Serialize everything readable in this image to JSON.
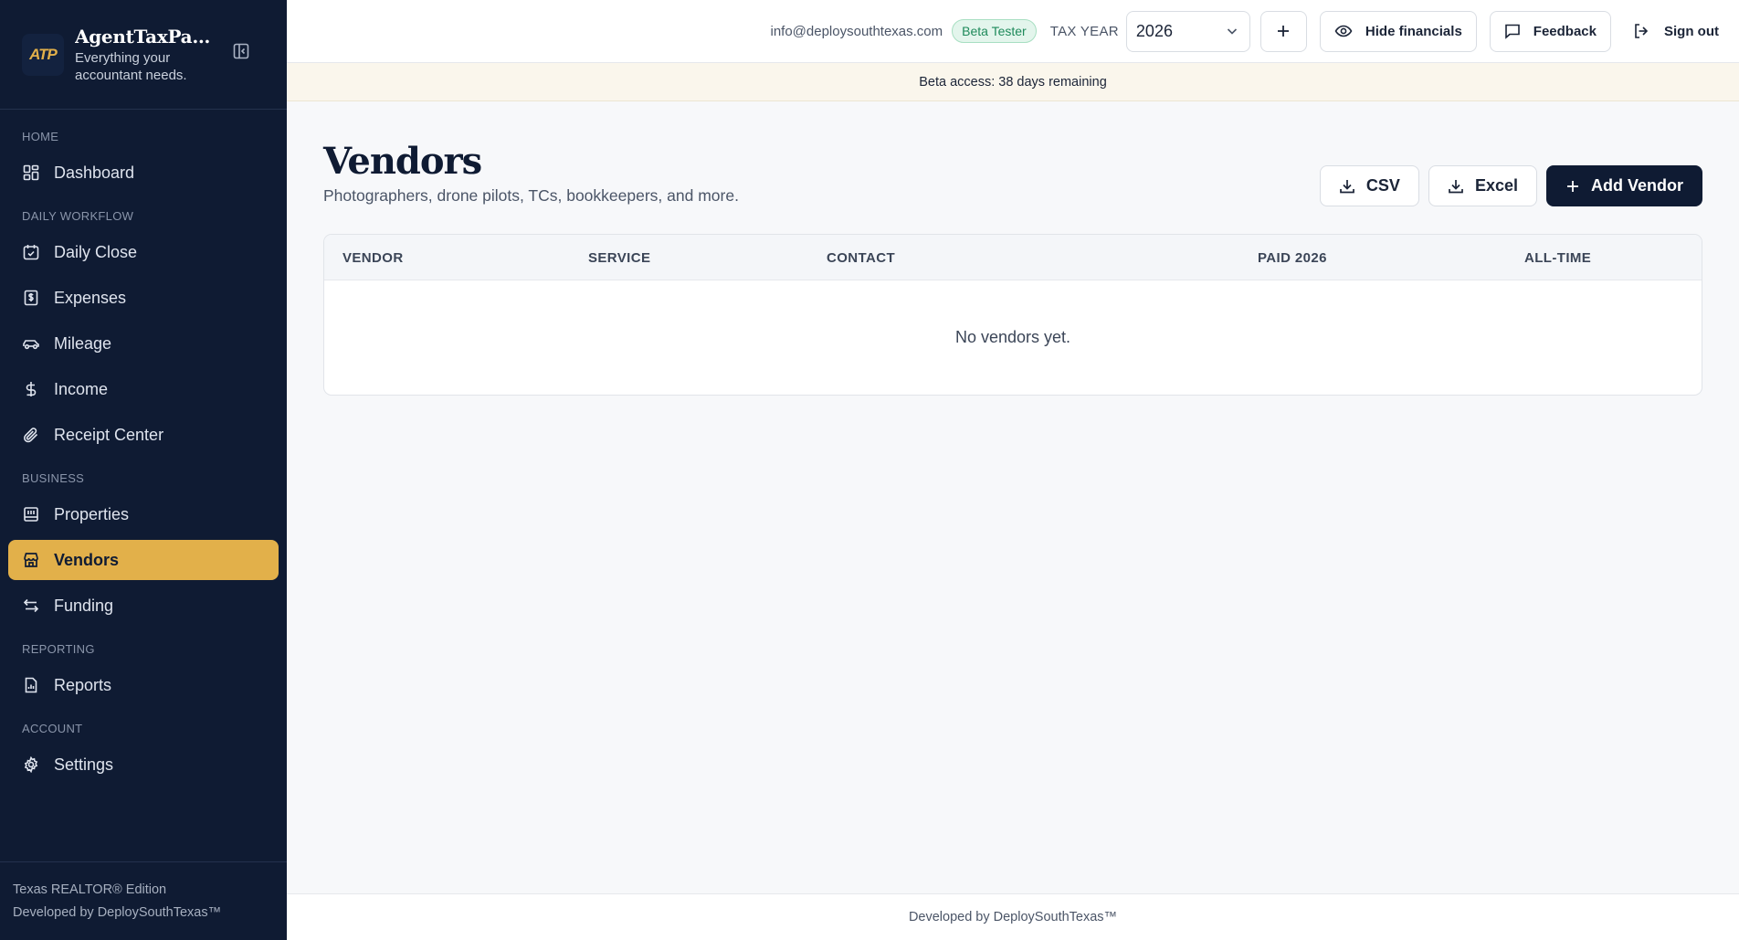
{
  "app": {
    "logo_text": "ATP",
    "name": "AgentTaxPack...",
    "tagline": "Everything your accountant needs."
  },
  "sidebar": {
    "sections": [
      {
        "label": "HOME",
        "items": [
          {
            "label": "Dashboard",
            "icon": "grid-icon"
          }
        ]
      },
      {
        "label": "DAILY WORKFLOW",
        "items": [
          {
            "label": "Daily Close",
            "icon": "calendar-check-icon"
          },
          {
            "label": "Expenses",
            "icon": "receipt-dollar-icon"
          },
          {
            "label": "Mileage",
            "icon": "car-icon"
          },
          {
            "label": "Income",
            "icon": "dollar-icon"
          },
          {
            "label": "Receipt Center",
            "icon": "paperclip-icon"
          }
        ]
      },
      {
        "label": "BUSINESS",
        "items": [
          {
            "label": "Properties",
            "icon": "building-icon"
          },
          {
            "label": "Vendors",
            "icon": "store-icon",
            "active": true
          },
          {
            "label": "Funding",
            "icon": "arrows-left-right-icon"
          }
        ]
      },
      {
        "label": "REPORTING",
        "items": [
          {
            "label": "Reports",
            "icon": "report-icon"
          }
        ]
      },
      {
        "label": "ACCOUNT",
        "items": [
          {
            "label": "Settings",
            "icon": "gear-icon"
          }
        ]
      }
    ],
    "footer_line1": "Texas REALTOR® Edition",
    "footer_line2": "Developed by DeploySouthTexas™"
  },
  "topbar": {
    "email": "info@deploysouthtexas.com",
    "badge": "Beta Tester",
    "tax_year_label": "TAX YEAR",
    "tax_year_value": "2026",
    "hide_financials": "Hide financials",
    "feedback": "Feedback",
    "sign_out": "Sign out"
  },
  "banner": {
    "text": "Beta access: 38 days remaining"
  },
  "page": {
    "title": "Vendors",
    "subtitle": "Photographers, drone pilots, TCs, bookkeepers, and more.",
    "csv_label": "CSV",
    "excel_label": "Excel",
    "add_label": "Add Vendor"
  },
  "table": {
    "columns": [
      "VENDOR",
      "SERVICE",
      "CONTACT",
      "PAID 2026",
      "ALL-TIME"
    ],
    "empty_message": "No vendors yet."
  },
  "footer": {
    "text": "Developed by DeploySouthTexas™"
  },
  "colors": {
    "sidebar_bg": "#0f1b33",
    "accent": "#e2b04a",
    "primary_button": "#0f1b33",
    "banner_bg": "#faf6ec"
  }
}
